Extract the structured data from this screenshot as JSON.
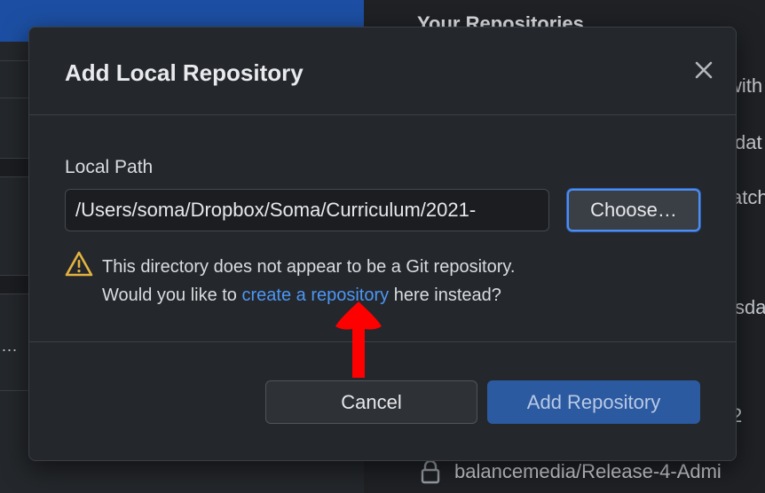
{
  "background": {
    "right_heading": "Your Repositories",
    "right_fragments": [
      "with",
      "dat",
      "atch",
      "sda",
      "2"
    ],
    "bottom_repo": "balancemedia/Release-4-Admi",
    "ellipsis": "..."
  },
  "dialog": {
    "title": "Add Local Repository",
    "close_icon": "close-icon",
    "local_path_label": "Local Path",
    "local_path_value": "/Users/soma/Dropbox/Soma/Curriculum/2021-",
    "choose_label": "Choose…",
    "warning": {
      "icon": "warning-icon",
      "line1": "This directory does not appear to be a Git repository.",
      "line2_prefix": "Would you like to ",
      "link_text": "create a repository",
      "line2_suffix": " here instead?"
    },
    "cancel_label": "Cancel",
    "add_label": "Add Repository"
  },
  "colors": {
    "accent_blue": "#4d8eef",
    "link_blue": "#4d97f5",
    "primary_button": "#2c5aa0",
    "warning_yellow": "#e3b341",
    "annotation_red": "#ff0000"
  }
}
